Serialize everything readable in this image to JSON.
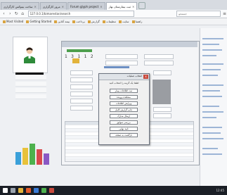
{
  "browser": {
    "tabs": [
      {
        "label": "ساخت بیتوکس کارگزاری",
        "active": false
      },
      {
        "label": "مرور کارگزاری",
        "active": false
      },
      {
        "label": "Forum glyph project",
        "active": false
      },
      {
        "label": "ثبت بیمارستان بهار",
        "active": true
      }
    ],
    "url": "127.0.0.1/bimarestan/search",
    "search_placeholder": "جستجو",
    "bookmarks": [
      "Most Visited",
      "Getting Started",
      "بیمه آنلاین",
      "پرداخت",
      "گزارش",
      "تنظیمات",
      "سایت",
      "راهنما"
    ]
  },
  "page": {
    "id_number": "1 3 1 1 2",
    "dialog": {
      "title": "انتخاب عملیات",
      "close_label": "x",
      "message": "لطفا یک گزینه را انتخاب کنید",
      "buttons": [
        "ثبت اطلاعات بیمار",
        "مشاهده پرونده",
        "ویرایش اطلاعات",
        "چاپ گزارش کامل",
        "ارسال مدارک",
        "بررسی سوابق",
        "تایید نهایی",
        "بازگشت به صفحه"
      ]
    }
  },
  "taskbar": {
    "time": "12:45"
  },
  "colors": {
    "accent_green": "#4d9e4d",
    "accent_yellow": "#e2b33a",
    "close_red": "#c94a3d"
  }
}
